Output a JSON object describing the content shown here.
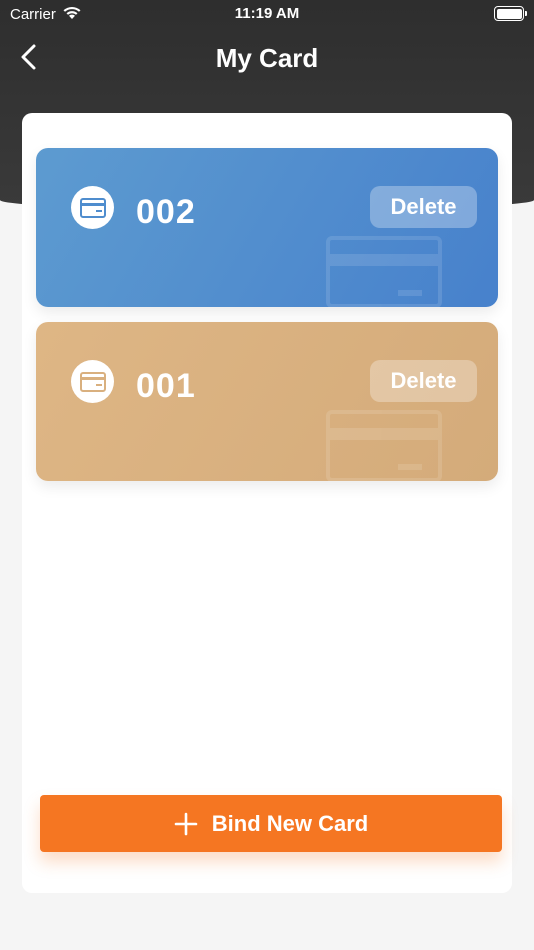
{
  "status_bar": {
    "carrier": "Carrier",
    "time": "11:19 AM",
    "wifi_icon": "wifi-icon",
    "battery_icon": "battery-icon"
  },
  "nav": {
    "title": "My Card",
    "back_icon": "chevron-left-icon"
  },
  "cards": [
    {
      "number": "002",
      "delete_label": "Delete",
      "color": "#4f8dce",
      "icon": "credit-card-icon"
    },
    {
      "number": "001",
      "delete_label": "Delete",
      "color": "#d9b07f",
      "icon": "credit-card-icon"
    }
  ],
  "bind_button": {
    "label": "Bind New Card",
    "icon": "plus-icon",
    "color": "#f57622"
  }
}
